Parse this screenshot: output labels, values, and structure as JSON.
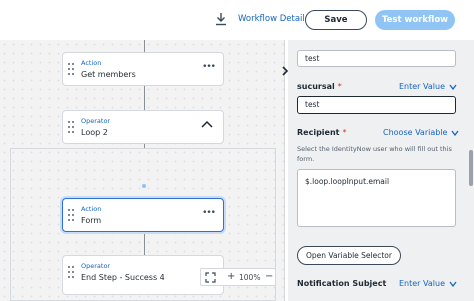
{
  "header": {
    "workflow_details_label": "Workflow Details",
    "save_label": "Save",
    "test_workflow_label": "Test workflow"
  },
  "canvas": {
    "nodes": [
      {
        "type": "Action",
        "name": "Get members"
      },
      {
        "type": "Operator",
        "name": "Loop 2"
      },
      {
        "type": "Action",
        "name": "Form"
      },
      {
        "type": "Operator",
        "name": "End Step - Success 4"
      }
    ],
    "more_glyph": "•••",
    "zoom": {
      "plus": "+",
      "level": "100%",
      "minus": "−"
    }
  },
  "panel": {
    "field1_value": "test",
    "sucursal": {
      "label": "sucursal",
      "required_mark": "*",
      "mode": "Enter Value",
      "value": "test"
    },
    "recipient": {
      "label": "Recipient",
      "required_mark": "*",
      "mode": "Choose Variable",
      "help": "Select the IdentityNow user who will fill out this form.",
      "value": "$.loop.loopInput.email"
    },
    "open_variable_selector_label": "Open Variable Selector",
    "notification_subject": {
      "label": "Notification Subject",
      "mode": "Enter Value"
    }
  },
  "colors": {
    "accent": "#1565c0",
    "primary_button": "#8fc4f5",
    "required": "#d32f2f",
    "selected_border": "#2f6fd6"
  }
}
